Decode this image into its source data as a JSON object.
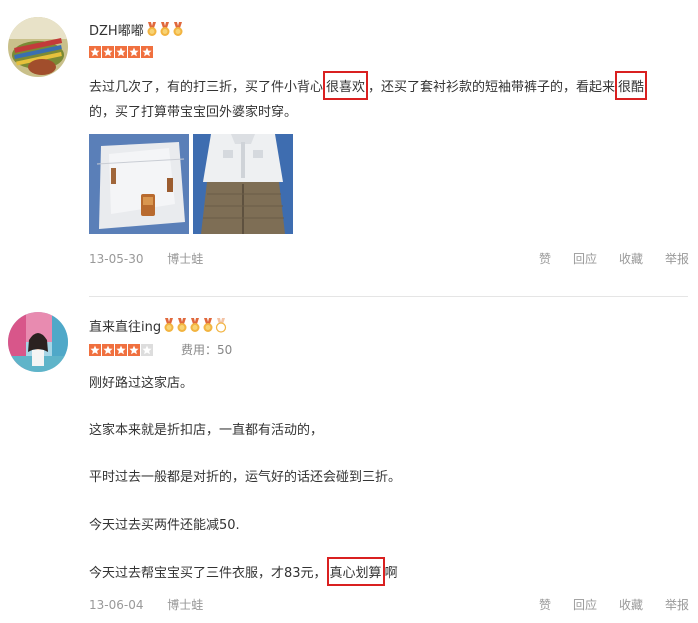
{
  "reviews": [
    {
      "username": "DZH嘟嘟",
      "medals": [
        "gold",
        "gold",
        "gold"
      ],
      "stars": 5,
      "cost": "",
      "text_line1_a": "去过几次了，有的打三折，买了件小背心",
      "text_line1_hl": "很喜欢",
      "text_line1_b": "，还买了套衬衫款的短袖带裤子的，看起来",
      "text_line1_hl2": "很酷",
      "text_line2": "的，买了打算带宝宝回外婆家时穿。",
      "date": "13-05-30",
      "user_tag": "博士蛙",
      "actions": [
        "赞",
        "回应",
        "收藏",
        "举报"
      ]
    },
    {
      "username": "直来直往ing",
      "medals": [
        "gold",
        "gold",
        "gold",
        "gold",
        "empty"
      ],
      "stars": 4,
      "cost": "费用：50",
      "paragraphs": [
        "刚好路过这家店。",
        "这家本来就是折扣店，一直都有活动的，",
        "平时过去一般都是对折的，运气好的话还会碰到三折。",
        "今天过去买两件还能减50."
      ],
      "last_a": "今天过去帮宝宝买了三件衣服，才83元，",
      "last_hl": "真心划算",
      "last_b": "啊",
      "date": "13-06-04",
      "user_tag": "博士蛙",
      "actions": [
        "赞",
        "回应",
        "收藏",
        "举报"
      ]
    }
  ],
  "colors": {
    "star": "#f0703f",
    "star_empty": "#dddddd",
    "highlight_box": "#d92020",
    "meta_text": "#999999"
  }
}
